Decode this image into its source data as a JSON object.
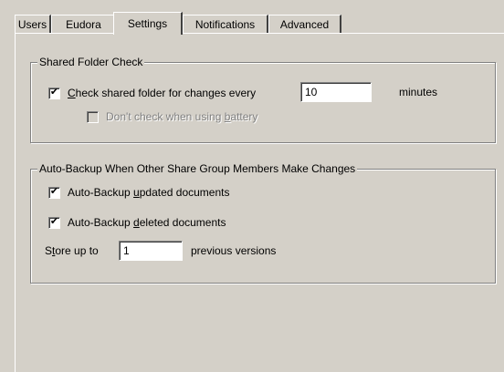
{
  "tabs": [
    {
      "label": "Users",
      "active": false
    },
    {
      "label": "Eudora",
      "active": false
    },
    {
      "label": "Settings",
      "active": true
    },
    {
      "label": "Notifications",
      "active": false
    },
    {
      "label": "Advanced",
      "active": false
    }
  ],
  "shared_folder": {
    "title": "Shared Folder Check",
    "check_label_mnemonic": "C",
    "check_label_rest": "heck shared folder for changes every",
    "check_checked": true,
    "interval_value": "10",
    "interval_unit": "minutes",
    "battery_label_pre": "Don't check when using ",
    "battery_label_mnemonic": "b",
    "battery_label_post": "attery",
    "battery_checked": false,
    "battery_enabled": false
  },
  "auto_backup": {
    "title": "Auto-Backup When Other Share Group Members Make Changes",
    "updated_pre": "Auto-Backup ",
    "updated_mnemonic": "u",
    "updated_post": "pdated documents",
    "updated_checked": true,
    "deleted_pre": "Auto-Backup ",
    "deleted_mnemonic": "d",
    "deleted_post": "eleted documents",
    "deleted_checked": true,
    "store_pre": "S",
    "store_mnemonic": "t",
    "store_post": "ore up to",
    "versions_value": "1",
    "versions_suffix": "previous versions"
  },
  "check_glyph": "✔"
}
